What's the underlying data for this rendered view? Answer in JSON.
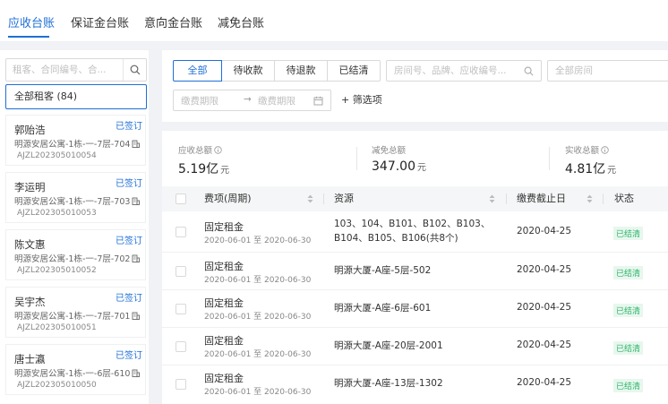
{
  "top_tabs": [
    {
      "label": "应收台账"
    },
    {
      "label": "保证金台账"
    },
    {
      "label": "意向金台账"
    },
    {
      "label": "减免台账"
    }
  ],
  "sidebar": {
    "search_placeholder": "租客、合同编号、合...",
    "all_tenants": "全部租客 (84)",
    "tenants": [
      {
        "name": "郭贻浩",
        "badge": "已签订",
        "address": "明源安居公寓-1栋-一-7层-704",
        "code": "AJZL202305010054"
      },
      {
        "name": "李运明",
        "badge": "已签订",
        "address": "明源安居公寓-1栋-一-7层-703",
        "code": "AJZL202305010053"
      },
      {
        "name": "陈文惠",
        "badge": "已签订",
        "address": "明源安居公寓-1栋-一-7层-702",
        "code": "AJZL202305010052"
      },
      {
        "name": "吴宇杰",
        "badge": "已签订",
        "address": "明源安居公寓-1栋-一-7层-701",
        "code": "AJZL202305010051"
      },
      {
        "name": "唐士瀛",
        "badge": "已签订",
        "address": "明源安居公寓-1栋-一-6层-610",
        "code": "AJZL202305010050"
      }
    ]
  },
  "filters": {
    "segments": [
      {
        "label": "全部"
      },
      {
        "label": "待收款"
      },
      {
        "label": "待退款"
      },
      {
        "label": "已结清"
      }
    ],
    "search_placeholder": "房间号、品牌、应收编号...",
    "room_placeholder": "全部房间",
    "date_start": "缴费期限",
    "date_arrow": "→",
    "date_end": "缴费期限",
    "more_filters": "+ 筛选项"
  },
  "stats": [
    {
      "label": "应收总额",
      "value": "5.19亿",
      "unit": "元"
    },
    {
      "label": "减免总额",
      "value": "347.00",
      "unit": "元"
    },
    {
      "label": "实收总额",
      "value": "4.81亿",
      "unit": "元"
    }
  ],
  "table": {
    "columns": [
      "费项(周期)",
      "资源",
      "缴费截止日",
      "状态"
    ],
    "rows": [
      {
        "fee": "固定租金",
        "period": "2020-06-01 至 2020-06-30",
        "resource": "103、104、B101、B102、B103、B104、B105、B106(共8个)",
        "due": "2020-04-25",
        "status": "已结清"
      },
      {
        "fee": "固定租金",
        "period": "2020-06-01 至 2020-06-30",
        "resource": "明源大厦-A座-5层-502",
        "due": "2020-04-25",
        "status": "已结清"
      },
      {
        "fee": "固定租金",
        "period": "2020-06-01 至 2020-06-30",
        "resource": "明源大厦-A座-6层-601",
        "due": "2020-04-25",
        "status": "已结清"
      },
      {
        "fee": "固定租金",
        "period": "2020-06-01 至 2020-06-30",
        "resource": "明源大厦-A座-20层-2001",
        "due": "2020-04-25",
        "status": "已结清"
      },
      {
        "fee": "固定租金",
        "period": "2020-06-01 至 2020-06-30",
        "resource": "明源大厦-A座-13层-1302",
        "due": "2020-04-25",
        "status": "已结清"
      }
    ]
  },
  "colors": {
    "accent": "#1f6fd6",
    "success": "#2bb56a",
    "background": "#f0f2f5"
  },
  "icons": [
    "search-icon",
    "building-icon",
    "calendar-icon",
    "info-icon",
    "sort-icon"
  ]
}
